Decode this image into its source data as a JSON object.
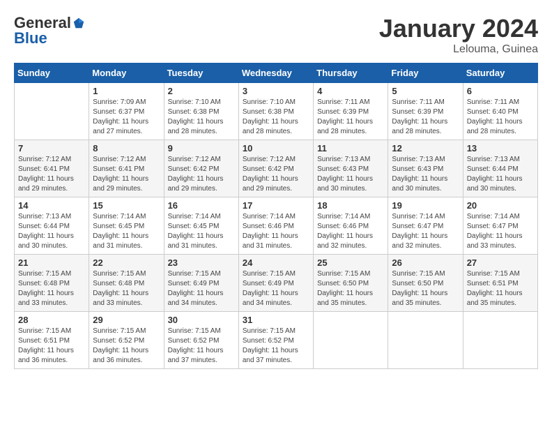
{
  "header": {
    "logo_general": "General",
    "logo_blue": "Blue",
    "month_title": "January 2024",
    "location": "Lelouma, Guinea"
  },
  "weekdays": [
    "Sunday",
    "Monday",
    "Tuesday",
    "Wednesday",
    "Thursday",
    "Friday",
    "Saturday"
  ],
  "weeks": [
    [
      {
        "day": "",
        "info": ""
      },
      {
        "day": "1",
        "info": "Sunrise: 7:09 AM\nSunset: 6:37 PM\nDaylight: 11 hours\nand 27 minutes."
      },
      {
        "day": "2",
        "info": "Sunrise: 7:10 AM\nSunset: 6:38 PM\nDaylight: 11 hours\nand 28 minutes."
      },
      {
        "day": "3",
        "info": "Sunrise: 7:10 AM\nSunset: 6:38 PM\nDaylight: 11 hours\nand 28 minutes."
      },
      {
        "day": "4",
        "info": "Sunrise: 7:11 AM\nSunset: 6:39 PM\nDaylight: 11 hours\nand 28 minutes."
      },
      {
        "day": "5",
        "info": "Sunrise: 7:11 AM\nSunset: 6:39 PM\nDaylight: 11 hours\nand 28 minutes."
      },
      {
        "day": "6",
        "info": "Sunrise: 7:11 AM\nSunset: 6:40 PM\nDaylight: 11 hours\nand 28 minutes."
      }
    ],
    [
      {
        "day": "7",
        "info": "Sunrise: 7:12 AM\nSunset: 6:41 PM\nDaylight: 11 hours\nand 29 minutes."
      },
      {
        "day": "8",
        "info": "Sunrise: 7:12 AM\nSunset: 6:41 PM\nDaylight: 11 hours\nand 29 minutes."
      },
      {
        "day": "9",
        "info": "Sunrise: 7:12 AM\nSunset: 6:42 PM\nDaylight: 11 hours\nand 29 minutes."
      },
      {
        "day": "10",
        "info": "Sunrise: 7:12 AM\nSunset: 6:42 PM\nDaylight: 11 hours\nand 29 minutes."
      },
      {
        "day": "11",
        "info": "Sunrise: 7:13 AM\nSunset: 6:43 PM\nDaylight: 11 hours\nand 30 minutes."
      },
      {
        "day": "12",
        "info": "Sunrise: 7:13 AM\nSunset: 6:43 PM\nDaylight: 11 hours\nand 30 minutes."
      },
      {
        "day": "13",
        "info": "Sunrise: 7:13 AM\nSunset: 6:44 PM\nDaylight: 11 hours\nand 30 minutes."
      }
    ],
    [
      {
        "day": "14",
        "info": "Sunrise: 7:13 AM\nSunset: 6:44 PM\nDaylight: 11 hours\nand 30 minutes."
      },
      {
        "day": "15",
        "info": "Sunrise: 7:14 AM\nSunset: 6:45 PM\nDaylight: 11 hours\nand 31 minutes."
      },
      {
        "day": "16",
        "info": "Sunrise: 7:14 AM\nSunset: 6:45 PM\nDaylight: 11 hours\nand 31 minutes."
      },
      {
        "day": "17",
        "info": "Sunrise: 7:14 AM\nSunset: 6:46 PM\nDaylight: 11 hours\nand 31 minutes."
      },
      {
        "day": "18",
        "info": "Sunrise: 7:14 AM\nSunset: 6:46 PM\nDaylight: 11 hours\nand 32 minutes."
      },
      {
        "day": "19",
        "info": "Sunrise: 7:14 AM\nSunset: 6:47 PM\nDaylight: 11 hours\nand 32 minutes."
      },
      {
        "day": "20",
        "info": "Sunrise: 7:14 AM\nSunset: 6:47 PM\nDaylight: 11 hours\nand 33 minutes."
      }
    ],
    [
      {
        "day": "21",
        "info": "Sunrise: 7:15 AM\nSunset: 6:48 PM\nDaylight: 11 hours\nand 33 minutes."
      },
      {
        "day": "22",
        "info": "Sunrise: 7:15 AM\nSunset: 6:48 PM\nDaylight: 11 hours\nand 33 minutes."
      },
      {
        "day": "23",
        "info": "Sunrise: 7:15 AM\nSunset: 6:49 PM\nDaylight: 11 hours\nand 34 minutes."
      },
      {
        "day": "24",
        "info": "Sunrise: 7:15 AM\nSunset: 6:49 PM\nDaylight: 11 hours\nand 34 minutes."
      },
      {
        "day": "25",
        "info": "Sunrise: 7:15 AM\nSunset: 6:50 PM\nDaylight: 11 hours\nand 35 minutes."
      },
      {
        "day": "26",
        "info": "Sunrise: 7:15 AM\nSunset: 6:50 PM\nDaylight: 11 hours\nand 35 minutes."
      },
      {
        "day": "27",
        "info": "Sunrise: 7:15 AM\nSunset: 6:51 PM\nDaylight: 11 hours\nand 35 minutes."
      }
    ],
    [
      {
        "day": "28",
        "info": "Sunrise: 7:15 AM\nSunset: 6:51 PM\nDaylight: 11 hours\nand 36 minutes."
      },
      {
        "day": "29",
        "info": "Sunrise: 7:15 AM\nSunset: 6:52 PM\nDaylight: 11 hours\nand 36 minutes."
      },
      {
        "day": "30",
        "info": "Sunrise: 7:15 AM\nSunset: 6:52 PM\nDaylight: 11 hours\nand 37 minutes."
      },
      {
        "day": "31",
        "info": "Sunrise: 7:15 AM\nSunset: 6:52 PM\nDaylight: 11 hours\nand 37 minutes."
      },
      {
        "day": "",
        "info": ""
      },
      {
        "day": "",
        "info": ""
      },
      {
        "day": "",
        "info": ""
      }
    ]
  ]
}
